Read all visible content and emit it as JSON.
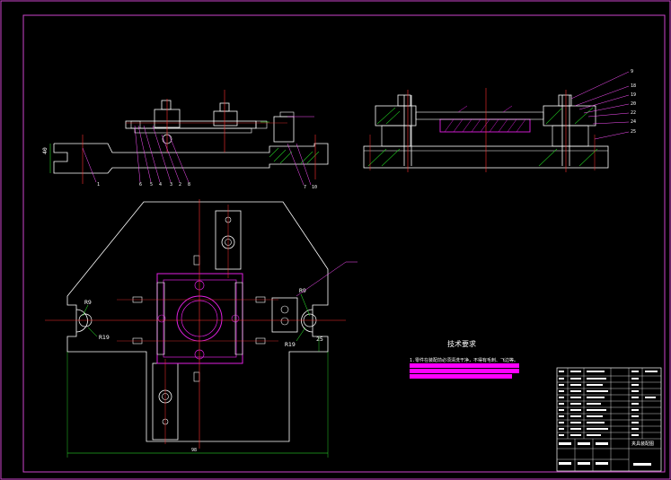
{
  "colors": {
    "background": "#000000",
    "frame": "#cc44cc",
    "outline": "#ffffff",
    "part_magenta": "#e020e0",
    "centerline": "#ff3030",
    "hatch": "#20c020",
    "leader": "#ff50ff",
    "dimension": "#30ff30",
    "highlight_bar": "#ff00ff"
  },
  "front_view": {
    "part_numbers": [
      "1",
      "6",
      "5",
      "4",
      "3",
      "2",
      "8",
      "7",
      "10"
    ],
    "height_dim": "40"
  },
  "side_view": {
    "part_numbers": [
      "9",
      "18",
      "19",
      "20",
      "22",
      "24",
      "25"
    ]
  },
  "plan_view": {
    "radius_labels": {
      "r9_left": "R9",
      "r19_left": "R19",
      "r9_right": "R9",
      "r19_right": "R19"
    },
    "right_dim": "25",
    "bottom_dim": "98"
  },
  "tech_requirements": {
    "title": "技术要求",
    "line1": "1.零件在装配前必须清洗干净，不得有毛刺、飞边等。"
  },
  "title_block": {
    "rows": 11,
    "drawing_number": "夹具装配图"
  }
}
